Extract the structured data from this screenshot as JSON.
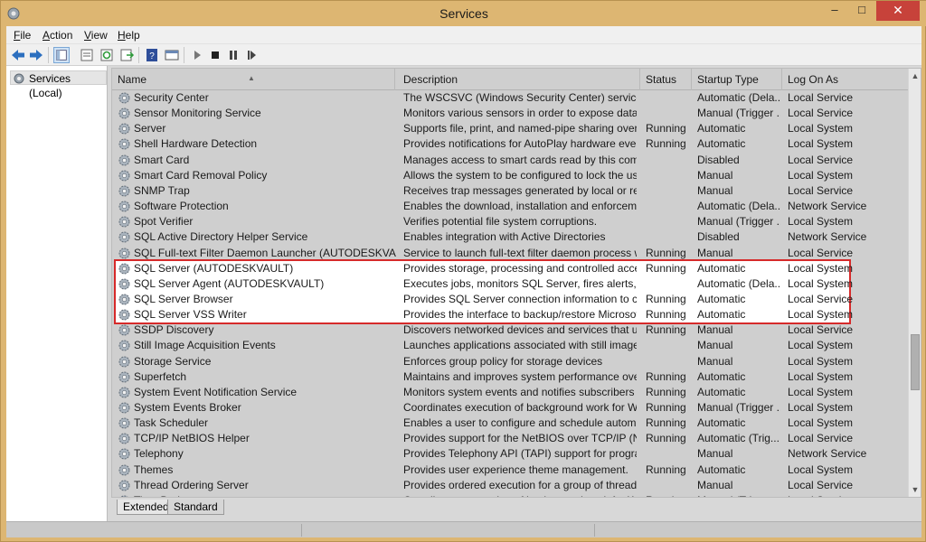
{
  "window": {
    "title": "Services"
  },
  "menu": {
    "file": "File",
    "action": "Action",
    "view": "View",
    "help": "Help"
  },
  "toolbar": {
    "buttons": [
      "back-icon",
      "forward-icon",
      "show-hide-tree-icon",
      "properties-icon",
      "refresh-icon",
      "export-list-icon",
      "help-icon",
      "console-icon",
      "start-icon",
      "stop-icon",
      "pause-icon",
      "restart-icon"
    ]
  },
  "tree": {
    "root": "Services (Local)"
  },
  "columns": {
    "name": "Name",
    "description": "Description",
    "status": "Status",
    "startup": "Startup Type",
    "logon": "Log On As"
  },
  "services": [
    {
      "name": "Security Center",
      "description": "The WSCSVC (Windows Security Center) service mo...",
      "status": "",
      "startup": "Automatic (Dela...",
      "logon": "Local Service"
    },
    {
      "name": "Sensor Monitoring Service",
      "description": "Monitors various sensors in order to expose data an...",
      "status": "",
      "startup": "Manual (Trigger ...",
      "logon": "Local Service"
    },
    {
      "name": "Server",
      "description": "Supports file, print, and named-pipe sharing over th...",
      "status": "Running",
      "startup": "Automatic",
      "logon": "Local System"
    },
    {
      "name": "Shell Hardware Detection",
      "description": "Provides notifications for AutoPlay hardware events.",
      "status": "Running",
      "startup": "Automatic",
      "logon": "Local System"
    },
    {
      "name": "Smart Card",
      "description": "Manages access to smart cards read by this comput...",
      "status": "",
      "startup": "Disabled",
      "logon": "Local Service"
    },
    {
      "name": "Smart Card Removal Policy",
      "description": "Allows the system to be configured to lock the user ...",
      "status": "",
      "startup": "Manual",
      "logon": "Local System"
    },
    {
      "name": "SNMP Trap",
      "description": "Receives trap messages generated by local or remot...",
      "status": "",
      "startup": "Manual",
      "logon": "Local Service"
    },
    {
      "name": "Software Protection",
      "description": "Enables the download, installation and enforcement...",
      "status": "",
      "startup": "Automatic (Dela...",
      "logon": "Network Service"
    },
    {
      "name": "Spot Verifier",
      "description": "Verifies potential file system corruptions.",
      "status": "",
      "startup": "Manual (Trigger ...",
      "logon": "Local System"
    },
    {
      "name": "SQL Active Directory Helper Service",
      "description": "Enables integration with Active Directories",
      "status": "",
      "startup": "Disabled",
      "logon": "Network Service"
    },
    {
      "name": "SQL Full-text Filter Daemon Launcher (AUTODESKVAULT)",
      "description": "Service to launch full-text filter daemon process whi...",
      "status": "Running",
      "startup": "Manual",
      "logon": "Local Service"
    },
    {
      "name": "SQL Server (AUTODESKVAULT)",
      "description": "Provides storage, processing and controlled access ...",
      "status": "Running",
      "startup": "Automatic",
      "logon": "Local System"
    },
    {
      "name": "SQL Server Agent (AUTODESKVAULT)",
      "description": "Executes jobs, monitors SQL Server, fires alerts, and ...",
      "status": "",
      "startup": "Automatic (Dela...",
      "logon": "Local System"
    },
    {
      "name": "SQL Server Browser",
      "description": "Provides SQL Server connection information to clien...",
      "status": "Running",
      "startup": "Automatic",
      "logon": "Local Service"
    },
    {
      "name": "SQL Server VSS Writer",
      "description": "Provides the interface to backup/restore Microsoft S...",
      "status": "Running",
      "startup": "Automatic",
      "logon": "Local System"
    },
    {
      "name": "SSDP Discovery",
      "description": "Discovers networked devices and services that use t...",
      "status": "Running",
      "startup": "Manual",
      "logon": "Local Service"
    },
    {
      "name": "Still Image Acquisition Events",
      "description": "Launches applications associated with still image ac...",
      "status": "",
      "startup": "Manual",
      "logon": "Local System"
    },
    {
      "name": "Storage Service",
      "description": "Enforces group policy for storage devices",
      "status": "",
      "startup": "Manual",
      "logon": "Local System"
    },
    {
      "name": "Superfetch",
      "description": "Maintains and improves system performance over ti...",
      "status": "Running",
      "startup": "Automatic",
      "logon": "Local System"
    },
    {
      "name": "System Event Notification Service",
      "description": "Monitors system events and notifies subscribers to ...",
      "status": "Running",
      "startup": "Automatic",
      "logon": "Local System"
    },
    {
      "name": "System Events Broker",
      "description": "Coordinates execution of background work for Win...",
      "status": "Running",
      "startup": "Manual (Trigger ...",
      "logon": "Local System"
    },
    {
      "name": "Task Scheduler",
      "description": "Enables a user to configure and schedule automate...",
      "status": "Running",
      "startup": "Automatic",
      "logon": "Local System"
    },
    {
      "name": "TCP/IP NetBIOS Helper",
      "description": "Provides support for the NetBIOS over TCP/IP (NetB...",
      "status": "Running",
      "startup": "Automatic (Trig...",
      "logon": "Local Service"
    },
    {
      "name": "Telephony",
      "description": "Provides Telephony API (TAPI) support for program...",
      "status": "",
      "startup": "Manual",
      "logon": "Network Service"
    },
    {
      "name": "Themes",
      "description": "Provides user experience theme management.",
      "status": "Running",
      "startup": "Automatic",
      "logon": "Local System"
    },
    {
      "name": "Thread Ordering Server",
      "description": "Provides ordered execution for a group of threads w...",
      "status": "",
      "startup": "Manual",
      "logon": "Local Service"
    },
    {
      "name": "Time Broker",
      "description": "Coordinates execution of background work for Win...",
      "status": "Running",
      "startup": "Manual (Trigger ...",
      "logon": "Local Service"
    }
  ],
  "highlighted_rows": [
    11,
    12,
    13,
    14
  ],
  "tabs": {
    "extended": "Extended",
    "standard": "Standard"
  },
  "colors": {
    "frame": "#ddb672",
    "highlight_border": "#d62a2a",
    "close_button": "#c7423a"
  }
}
